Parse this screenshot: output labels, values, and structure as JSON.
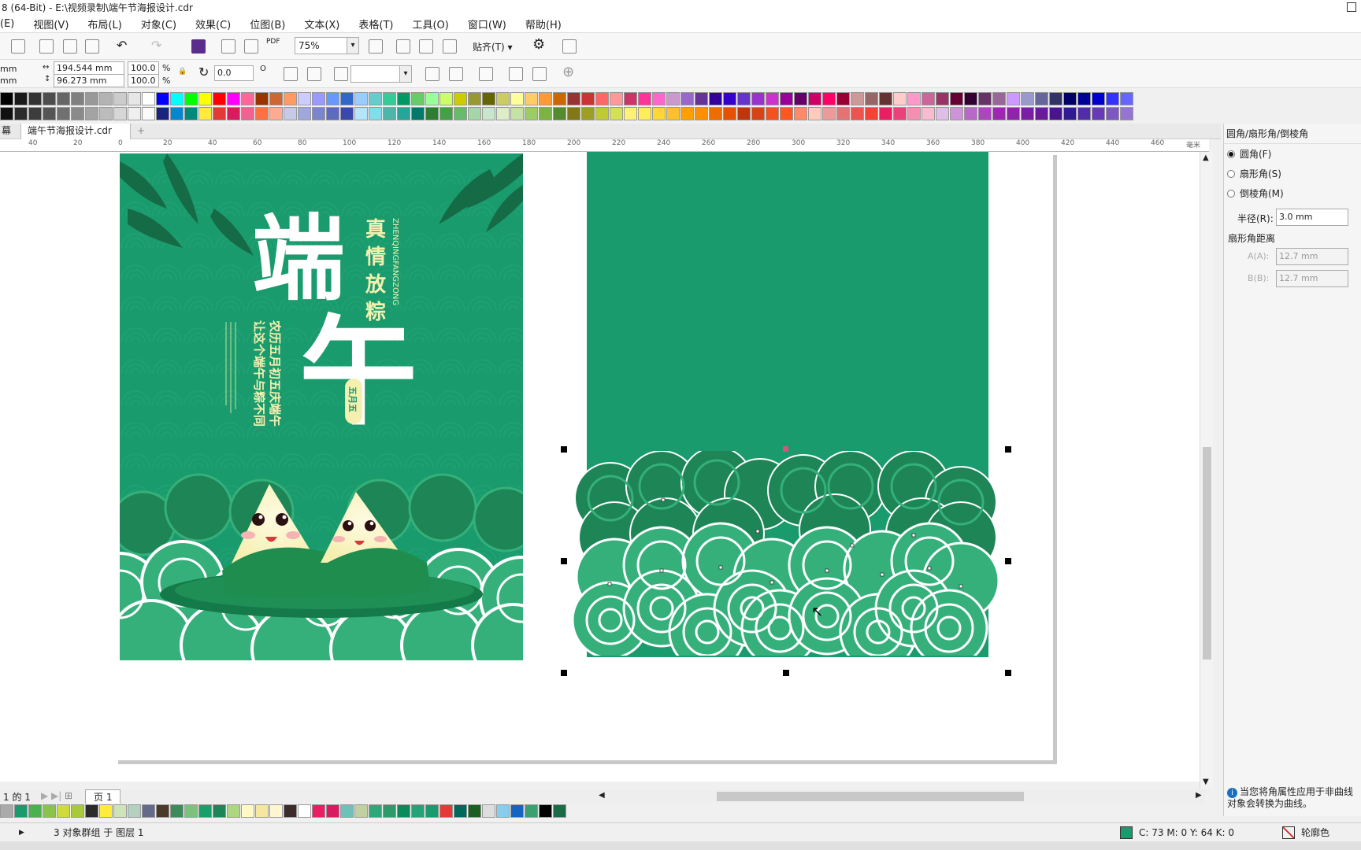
{
  "window": {
    "title": "8 (64-Bit) - E:\\视频录制\\端午节海报设计.cdr"
  },
  "menu": [
    "(E)",
    "视图(V)",
    "布局(L)",
    "对象(C)",
    "效果(C)",
    "位图(B)",
    "文本(X)",
    "表格(T)",
    "工具(O)",
    "窗口(W)",
    "帮助(H)"
  ],
  "toolbar": {
    "zoom": "75%",
    "snap_label": "贴齐(T)",
    "pdf_label": "PDF"
  },
  "propbar": {
    "x_unit_top": "mm",
    "x_unit_bottom": "mm",
    "width": "194.544 mm",
    "height": "96.273 mm",
    "scale_w": "100.0",
    "scale_h": "100.0",
    "pct": "%",
    "rotation": "0.0",
    "deg": "O"
  },
  "tabs": {
    "left_fragment": "幕",
    "document": "端午节海报设计.cdr",
    "add": "+"
  },
  "ruler_labels": [
    "40",
    "20",
    "0",
    "20",
    "40",
    "60",
    "80",
    "100",
    "120",
    "140",
    "160",
    "180",
    "200",
    "220",
    "240",
    "260",
    "280",
    "300",
    "320",
    "340",
    "360",
    "380",
    "400",
    "420",
    "440",
    "460",
    "毫米"
  ],
  "poster": {
    "title_vertical_1": "端",
    "title_vertical_2": "午",
    "slogan": [
      "真",
      "情",
      "放",
      "粽"
    ],
    "pinyin": "ZHENQINGFANGZONG",
    "col1": "农历五月初五庆端午",
    "col2": "让这个端午与粽不同",
    "seal": "五月五"
  },
  "docker": {
    "title": "圆角/扇形角/倒棱角",
    "opt1": "圆角(F)",
    "opt2": "扇形角(S)",
    "opt3": "倒棱角(M)",
    "radius_label": "半径(R):",
    "radius_value": "3.0 mm",
    "section": "扇形角距离",
    "a_label": "A(A):",
    "a_value": "12.7 mm",
    "b_label": "B(B):",
    "b_value": "12.7 mm",
    "info": "当您将角属性应用于非曲线对象会转换为曲线。"
  },
  "pagenav": {
    "counter": "1 的 1",
    "page_tab": "页 1"
  },
  "status": {
    "message": "3 对象群组 于 图层 1",
    "fill": "C: 73 M: 0 Y: 64 K: 0",
    "outline": "轮廓色"
  },
  "colors": {
    "poster_green": "#1a9b6e",
    "wave_dark": "#1e8557",
    "wave_light": "#35b07b",
    "cream": "#fef7c2"
  }
}
